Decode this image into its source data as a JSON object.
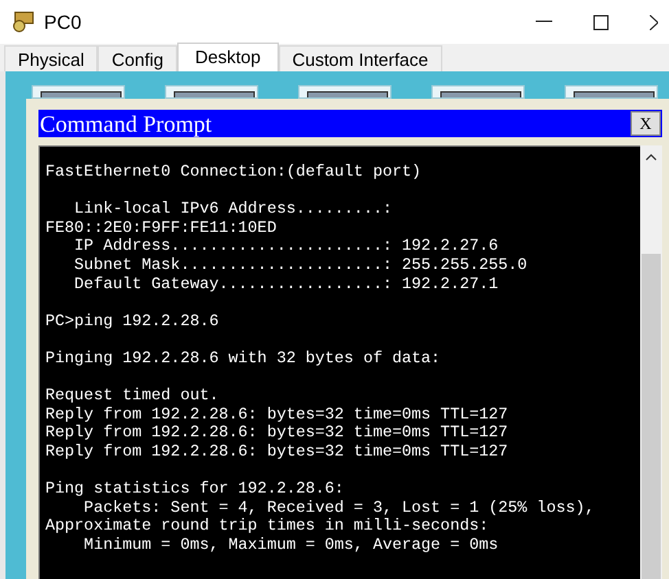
{
  "window": {
    "title": "PC0"
  },
  "tabs": [
    {
      "label": "Physical",
      "selected": false
    },
    {
      "label": "Config",
      "selected": false
    },
    {
      "label": "Desktop",
      "selected": true
    },
    {
      "label": "Custom Interface",
      "selected": false
    }
  ],
  "command_prompt": {
    "title": "Command Prompt",
    "close": "X",
    "blocks": [
      [
        "FastEthernet0 Connection:(default port)"
      ],
      [
        "   Link-local IPv6 Address.........:",
        "FE80::2E0:F9FF:FE11:10ED",
        "   IP Address......................: 192.2.27.6",
        "   Subnet Mask.....................: 255.255.255.0",
        "   Default Gateway.................: 192.2.27.1"
      ],
      [
        "PC>ping 192.2.28.6"
      ],
      [
        "Pinging 192.2.28.6 with 32 bytes of data:"
      ],
      [
        "Request timed out.",
        "Reply from 192.2.28.6: bytes=32 time=0ms TTL=127",
        "Reply from 192.2.28.6: bytes=32 time=0ms TTL=127",
        "Reply from 192.2.28.6: bytes=32 time=0ms TTL=127"
      ],
      [
        "Ping statistics for 192.2.28.6:",
        "    Packets: Sent = 4, Received = 3, Lost = 1 (25% loss),",
        "Approximate round trip times in milli-seconds:",
        "    Minimum = 0ms, Maximum = 0ms, Average = 0ms"
      ]
    ]
  }
}
